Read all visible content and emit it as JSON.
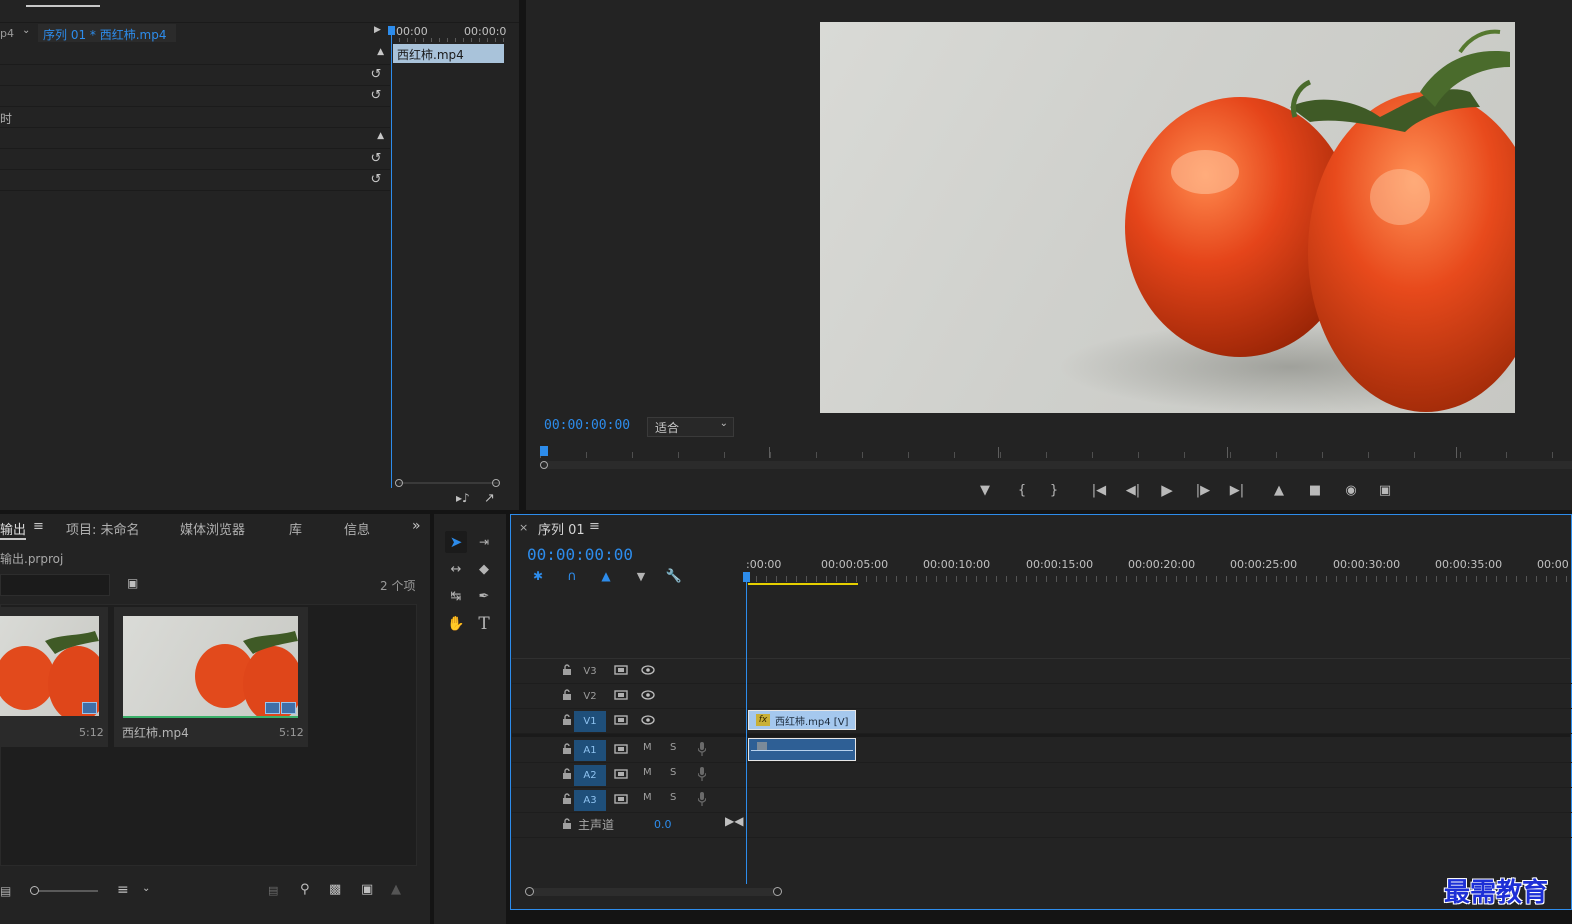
{
  "effect_controls": {
    "clip_prefix": "p4",
    "sequence_clip": "序列 01 * 西红柿.mp4",
    "ruler_start": "00:00",
    "ruler_end": "00:00:0",
    "clip_bar": "西红柿.mp4",
    "row_label_partial": "时"
  },
  "program_monitor": {
    "timecode": "00:00:00:00",
    "zoom": "适合"
  },
  "project": {
    "tabs": [
      "输出",
      "项目: 未命名",
      "媒体浏览器",
      "库",
      "信息"
    ],
    "project_file": "输出.prproj",
    "item_count": "2 个项",
    "items": [
      {
        "name": "",
        "duration": "5:12"
      },
      {
        "name": "西红柿.mp4",
        "duration": "5:12"
      }
    ]
  },
  "timeline": {
    "sequence_name": "序列 01",
    "timecode": "00:00:00:00",
    "ruler_labels": [
      ":00:00",
      "00:00:05:00",
      "00:00:10:00",
      "00:00:15:00",
      "00:00:20:00",
      "00:00:25:00",
      "00:00:30:00",
      "00:00:35:00",
      "00:00"
    ],
    "video_tracks": [
      "V3",
      "V2",
      "V1"
    ],
    "audio_tracks": [
      "A1",
      "A2",
      "A3"
    ],
    "mute_label": "M",
    "solo_label": "S",
    "master": {
      "label": "主声道",
      "value": "0.0"
    },
    "video_clip": "西红柿.mp4 [V]",
    "fx_badge": "fx"
  },
  "watermark": "最需教育",
  "colors": {
    "accent": "#2d8ceb",
    "clip_video": "#a5c8ee",
    "clip_audio": "#2e5f95",
    "workarea": "#e6d000"
  }
}
